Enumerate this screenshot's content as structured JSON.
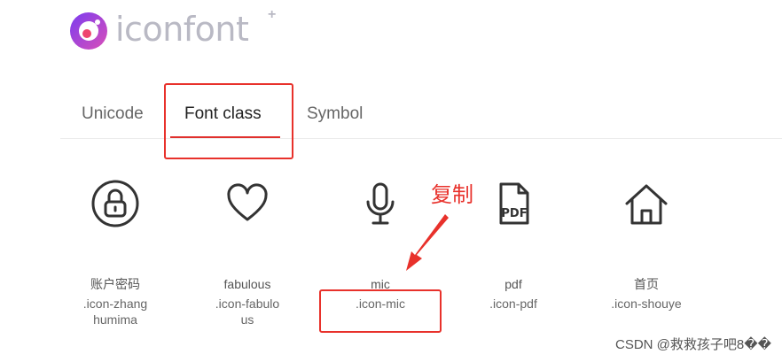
{
  "logo": {
    "text": "iconfont",
    "plus": "+"
  },
  "tabs": [
    {
      "label": "Unicode",
      "active": false
    },
    {
      "label": "Font class",
      "active": true
    },
    {
      "label": "Symbol",
      "active": false
    }
  ],
  "icons": [
    {
      "icon": "lock-circle-icon",
      "name": "账户密码",
      "class": ".icon-zhanghumima"
    },
    {
      "icon": "heart-icon",
      "name": "fabulous",
      "class": ".icon-fabulous"
    },
    {
      "icon": "mic-icon",
      "name": "mic",
      "class": ".icon-mic"
    },
    {
      "icon": "pdf-icon",
      "name": "pdf",
      "class": ".icon-pdf"
    },
    {
      "icon": "home-icon",
      "name": "首页",
      "class": ".icon-shouye"
    }
  ],
  "pdf_glyph_text": "PDF",
  "annotation": {
    "label": "复制",
    "color": "#e8312b"
  },
  "watermark": "CSDN @救救孩子吧8��",
  "colors": {
    "accent": "#e0302d",
    "logo_gradient_start": "#7b3cf0",
    "logo_gradient_end": "#e846a8"
  }
}
